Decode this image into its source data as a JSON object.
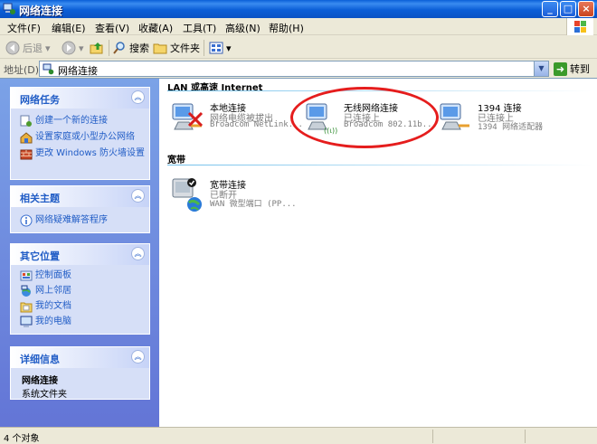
{
  "window": {
    "title": "网络连接",
    "buttons": {
      "minimize": "_",
      "maximize": "□",
      "close": "×"
    }
  },
  "menu": [
    "文件(F)",
    "编辑(E)",
    "查看(V)",
    "收藏(A)",
    "工具(T)",
    "高级(N)",
    "帮助(H)"
  ],
  "toolbar": {
    "back": "后退",
    "search": "搜索",
    "folders": "文件夹"
  },
  "address": {
    "label": "地址(D)",
    "value": "网络连接",
    "go": "转到"
  },
  "left_pane": {
    "network_tasks": {
      "title": "网络任务",
      "items": [
        {
          "label": "创建一个新的连接",
          "icon": "new-connection-icon"
        },
        {
          "label": "设置家庭或小型办公网络",
          "icon": "home-network-icon"
        },
        {
          "label": "更改 Windows 防火墙设置",
          "icon": "firewall-icon"
        }
      ]
    },
    "related_topics": {
      "title": "相关主题",
      "items": [
        {
          "label": "网络疑难解答程序",
          "icon": "info-icon"
        }
      ]
    },
    "other_places": {
      "title": "其它位置",
      "items": [
        {
          "label": "控制面板",
          "icon": "control-panel-icon"
        },
        {
          "label": "网上邻居",
          "icon": "network-places-icon"
        },
        {
          "label": "我的文档",
          "icon": "my-documents-icon"
        },
        {
          "label": "我的电脑",
          "icon": "my-computer-icon"
        }
      ]
    },
    "details": {
      "title": "详细信息",
      "name": "网络连接",
      "type": "系统文件夹"
    }
  },
  "content": {
    "lan_section": "LAN 或高速 Internet",
    "broadband_section": "宽带",
    "connections": [
      {
        "name": "本地连接",
        "status": "网络电缆被拔出",
        "device": "Broadcom NetLink...",
        "icon": "lan-disconnected-icon"
      },
      {
        "name": "无线网络连接",
        "status": "已连接上",
        "device": "Broadcom 802.11b...",
        "icon": "wireless-connection-icon"
      },
      {
        "name": "1394 连接",
        "status": "已连接上",
        "device": "1394 网络适配器",
        "icon": "firewire-connection-icon"
      },
      {
        "name": "宽带连接",
        "status": "已断开",
        "device": "WAN 微型端口 (PP...",
        "icon": "broadband-connection-icon"
      }
    ]
  },
  "statusbar": {
    "text": "4 个对象"
  },
  "colors": {
    "xp_blue": "#0A5FD8",
    "task_link": "#215DC6",
    "highlight_ellipse": "#E51D1D"
  }
}
